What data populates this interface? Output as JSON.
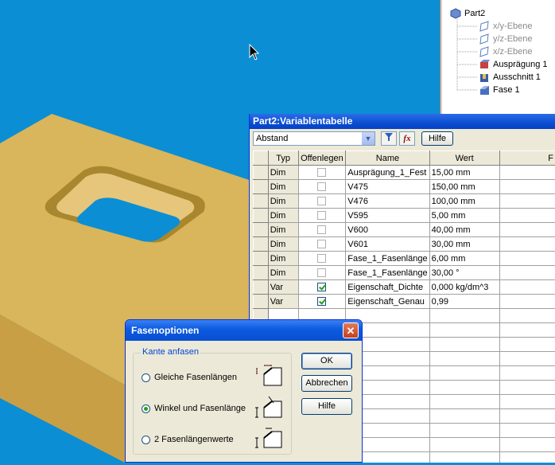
{
  "tree": {
    "items": [
      {
        "label": "Part2",
        "icon": "part-icon",
        "dim": false
      },
      {
        "label": "x/y-Ebene",
        "icon": "plane-icon",
        "dim": true
      },
      {
        "label": "y/z-Ebene",
        "icon": "plane-icon",
        "dim": true
      },
      {
        "label": "x/z-Ebene",
        "icon": "plane-icon",
        "dim": true
      },
      {
        "label": "Ausprägung 1",
        "icon": "extrude-icon",
        "dim": false
      },
      {
        "label": "Ausschnitt 1",
        "icon": "cutout-icon",
        "dim": false
      },
      {
        "label": "Fase 1",
        "icon": "chamfer-icon",
        "dim": false
      }
    ]
  },
  "vartable": {
    "title": "Part2:Variablentabelle",
    "filter_value": "Abstand",
    "help_label": "Hilfe",
    "columns": [
      "Typ",
      "Offenlegen",
      "Name",
      "Wert",
      "F"
    ],
    "rows": [
      {
        "typ": "Dim",
        "expose": false,
        "name": "Ausprägung_1_Fest",
        "value": "15,00 mm"
      },
      {
        "typ": "Dim",
        "expose": false,
        "name": "V475",
        "value": "150,00 mm"
      },
      {
        "typ": "Dim",
        "expose": false,
        "name": "V476",
        "value": "100,00 mm"
      },
      {
        "typ": "Dim",
        "expose": false,
        "name": "V595",
        "value": "5,00 mm"
      },
      {
        "typ": "Dim",
        "expose": false,
        "name": "V600",
        "value": "40,00 mm"
      },
      {
        "typ": "Dim",
        "expose": false,
        "name": "V601",
        "value": "30,00 mm"
      },
      {
        "typ": "Dim",
        "expose": false,
        "name": "Fase_1_Fasenlänge",
        "value": "6,00 mm"
      },
      {
        "typ": "Dim",
        "expose": false,
        "name": "Fase_1_Fasenlänge",
        "value": "30,00 °"
      },
      {
        "typ": "Var",
        "expose": true,
        "name": "Eigenschaft_Dichte",
        "value": "0,000 kg/dm^3"
      },
      {
        "typ": "Var",
        "expose": true,
        "name": "Eigenschaft_Genau",
        "value": "0,99"
      }
    ]
  },
  "dialog": {
    "title": "Fasenoptionen",
    "group_label": "Kante anfasen",
    "options": [
      {
        "label": "Gleiche Fasenlängen",
        "selected": false
      },
      {
        "label": "Winkel und Fasenlänge",
        "selected": true
      },
      {
        "label": "2 Fasenlängenwerte",
        "selected": false
      }
    ],
    "ok_label": "OK",
    "cancel_label": "Abbrechen",
    "help_label": "Hilfe"
  },
  "colors": {
    "viewport_bg": "#0b8ed4",
    "part_face": "#d8b055",
    "titlebar": "#0a4fd0"
  }
}
